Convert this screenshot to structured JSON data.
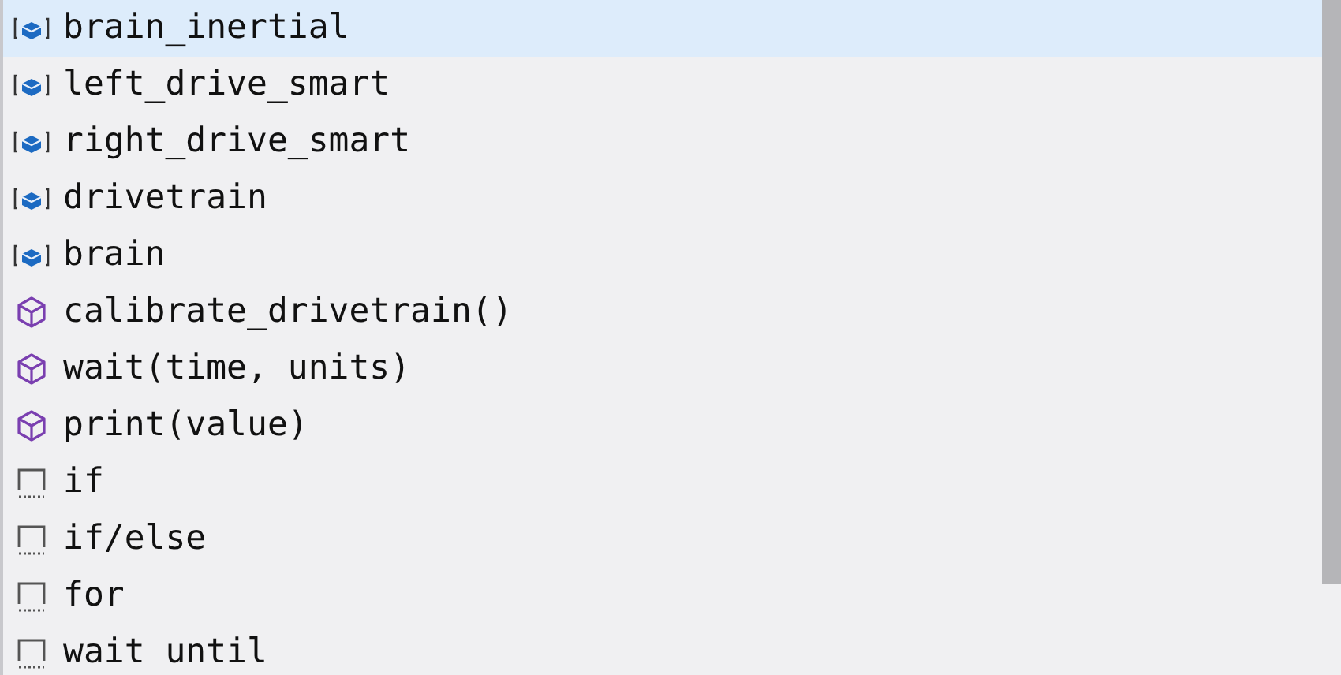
{
  "suggestions": [
    {
      "label": "brain_inertial",
      "kind": "variable",
      "selected": true
    },
    {
      "label": "left_drive_smart",
      "kind": "variable",
      "selected": false
    },
    {
      "label": "right_drive_smart",
      "kind": "variable",
      "selected": false
    },
    {
      "label": "drivetrain",
      "kind": "variable",
      "selected": false
    },
    {
      "label": "brain",
      "kind": "variable",
      "selected": false
    },
    {
      "label": "calibrate_drivetrain()",
      "kind": "method",
      "selected": false
    },
    {
      "label": "wait(time, units)",
      "kind": "method",
      "selected": false
    },
    {
      "label": "print(value)",
      "kind": "method",
      "selected": false
    },
    {
      "label": "if",
      "kind": "snippet",
      "selected": false
    },
    {
      "label": "if/else",
      "kind": "snippet",
      "selected": false
    },
    {
      "label": "for",
      "kind": "snippet",
      "selected": false
    },
    {
      "label": "wait until",
      "kind": "snippet",
      "selected": false
    }
  ]
}
